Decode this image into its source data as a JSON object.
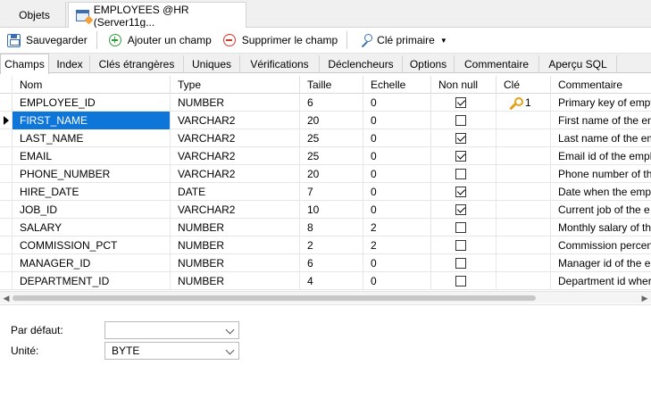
{
  "doc_tabs": {
    "objets": "Objets",
    "active": "EMPLOYEES @HR (Server11g..."
  },
  "toolbar": {
    "save": "Sauvegarder",
    "add_field": "Ajouter un champ",
    "remove_field": "Supprimer le champ",
    "primary_key": "Clé primaire"
  },
  "sub_tabs": [
    "Champs",
    "Index",
    "Clés étrangères",
    "Uniques",
    "Vérifications",
    "Déclencheurs",
    "Options",
    "Commentaire",
    "Aperçu SQL"
  ],
  "columns": [
    "Nom",
    "Type",
    "Taille",
    "Echelle",
    "Non null",
    "Clé",
    "Commentaire"
  ],
  "rows": [
    {
      "nom": "EMPLOYEE_ID",
      "type": "NUMBER",
      "taille": "6",
      "echelle": "0",
      "non_null": true,
      "cle": "1",
      "commentaire": "Primary key of empt"
    },
    {
      "nom": "FIRST_NAME",
      "type": "VARCHAR2",
      "taille": "20",
      "echelle": "0",
      "non_null": false,
      "cle": "",
      "commentaire": "First name of the en"
    },
    {
      "nom": "LAST_NAME",
      "type": "VARCHAR2",
      "taille": "25",
      "echelle": "0",
      "non_null": true,
      "cle": "",
      "commentaire": "Last name of the em"
    },
    {
      "nom": "EMAIL",
      "type": "VARCHAR2",
      "taille": "25",
      "echelle": "0",
      "non_null": true,
      "cle": "",
      "commentaire": "Email id of the empl"
    },
    {
      "nom": "PHONE_NUMBER",
      "type": "VARCHAR2",
      "taille": "20",
      "echelle": "0",
      "non_null": false,
      "cle": "",
      "commentaire": "Phone number of th"
    },
    {
      "nom": "HIRE_DATE",
      "type": "DATE",
      "taille": "7",
      "echelle": "0",
      "non_null": true,
      "cle": "",
      "commentaire": "Date when the empl"
    },
    {
      "nom": "JOB_ID",
      "type": "VARCHAR2",
      "taille": "10",
      "echelle": "0",
      "non_null": true,
      "cle": "",
      "commentaire": "Current job of the e"
    },
    {
      "nom": "SALARY",
      "type": "NUMBER",
      "taille": "8",
      "echelle": "2",
      "non_null": false,
      "cle": "",
      "commentaire": "Monthly salary of th"
    },
    {
      "nom": "COMMISSION_PCT",
      "type": "NUMBER",
      "taille": "2",
      "echelle": "2",
      "non_null": false,
      "cle": "",
      "commentaire": "Commission percen"
    },
    {
      "nom": "MANAGER_ID",
      "type": "NUMBER",
      "taille": "6",
      "echelle": "0",
      "non_null": false,
      "cle": "",
      "commentaire": "Manager id of the e"
    },
    {
      "nom": "DEPARTMENT_ID",
      "type": "NUMBER",
      "taille": "4",
      "echelle": "0",
      "non_null": false,
      "cle": "",
      "commentaire": "Department id wher"
    }
  ],
  "selected_row": 1,
  "props": {
    "default_label": "Par défaut:",
    "default_value": "",
    "unit_label": "Unité:",
    "unit_value": "BYTE"
  },
  "colors": {
    "selection": "#0e76d9",
    "key": "#e3a21a",
    "add": "#2f9e3a",
    "remove": "#d9362b"
  }
}
